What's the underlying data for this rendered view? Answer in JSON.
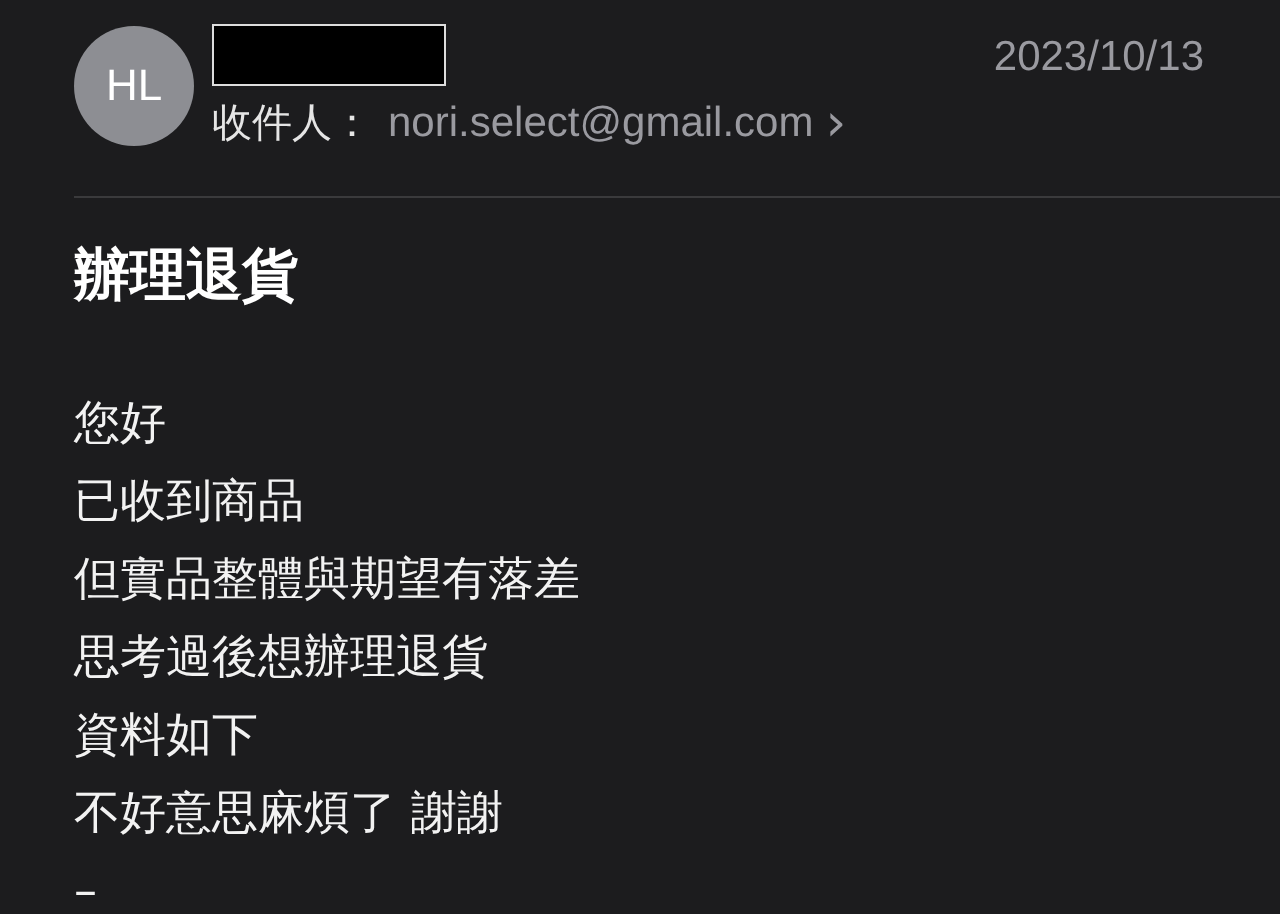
{
  "header": {
    "avatar": "HL",
    "date": "2023/10/13",
    "recipient_label": "收件人：",
    "recipient": "nori.select@gmail.com",
    "chevron": "›"
  },
  "subject": "辦理退貨",
  "body": [
    "您好",
    "已收到商品",
    "但實品整體與期望有落差",
    "思考過後想辦理退貨",
    "資料如下",
    "不好意思麻煩了 謝謝",
    "–"
  ]
}
